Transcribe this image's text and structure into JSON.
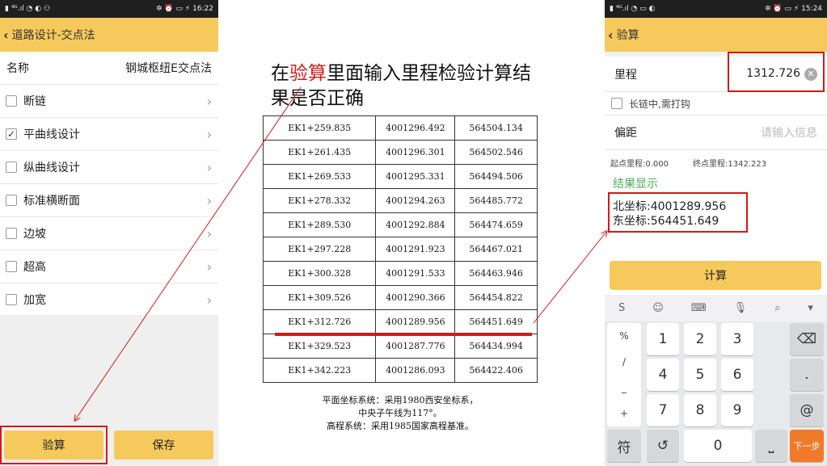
{
  "left": {
    "status_time": "16:22",
    "status_left": "▮ ⁴ᴳ.ıl ◔ ◐ ⚇",
    "status_right": "✲ ⏰ ▭ ⚡",
    "title": "道路设计-交点法",
    "name_label": "名称",
    "name_value": "钢城枢纽E交点法",
    "items": [
      {
        "label": "断链",
        "checked": false
      },
      {
        "label": "平曲线设计",
        "checked": true
      },
      {
        "label": "纵曲线设计",
        "checked": false
      },
      {
        "label": "标准横断面",
        "checked": false
      },
      {
        "label": "边坡",
        "checked": false
      },
      {
        "label": "超高",
        "checked": false
      },
      {
        "label": "加宽",
        "checked": false
      }
    ],
    "verify_button": "验算",
    "save_button": "保存"
  },
  "instruction": {
    "part1": "在",
    "highlight": "验算",
    "part2": "里面输入里程检验计算结果是否正确"
  },
  "table": {
    "rows": [
      [
        "EK1+259.835",
        "4001296.492",
        "564504.134"
      ],
      [
        "EK1+261.435",
        "4001296.301",
        "564502.546"
      ],
      [
        "EK1+269.533",
        "4001295.331",
        "564494.506"
      ],
      [
        "EK1+278.332",
        "4001294.263",
        "564485.772"
      ],
      [
        "EK1+289.530",
        "4001292.884",
        "564474.659"
      ],
      [
        "EK1+297.228",
        "4001291.923",
        "564467.021"
      ],
      [
        "EK1+300.328",
        "4001291.533",
        "564463.946"
      ],
      [
        "EK1+309.526",
        "4001290.366",
        "564454.822"
      ],
      [
        "EK1+312.726",
        "4001289.956",
        "564451.649"
      ],
      [
        "EK1+329.523",
        "4001287.776",
        "564434.994"
      ],
      [
        "EK1+342.223",
        "4001286.093",
        "564422.406"
      ]
    ],
    "note_line1": "平面坐标系统：采用1980西安坐标系，",
    "note_line2": "中央子午线为117°。",
    "note_line3": "高程系统：采用1985国家高程基准。"
  },
  "right": {
    "status_time": "15:24",
    "status_left": "▮ ⁴ᴳ.ıl ◔ ▭ ◐",
    "status_right": "✲ ⏰ ▭ ⚡",
    "title": "验算",
    "mileage_label": "里程",
    "mileage_value": "1312.726",
    "long_chain_label": "长链中,需打钩",
    "offset_label": "偏距",
    "offset_placeholder": "请输入信息",
    "start_mileage": "起点里程:0.000",
    "end_mileage": "终点里程:1342.223",
    "result_title": "结果显示",
    "north_coord": "北坐标:4001289.956",
    "east_coord": "东坐标:564451.649",
    "calc_button": "计算",
    "keyboard": {
      "side_keys": [
        "%",
        "/",
        "_",
        "+"
      ],
      "digits": [
        "1",
        "2",
        "3",
        "4",
        "5",
        "6",
        "7",
        "8",
        "9",
        "0"
      ],
      "dot": ".",
      "at": "@",
      "symbol": "符",
      "next": "下一步"
    }
  }
}
